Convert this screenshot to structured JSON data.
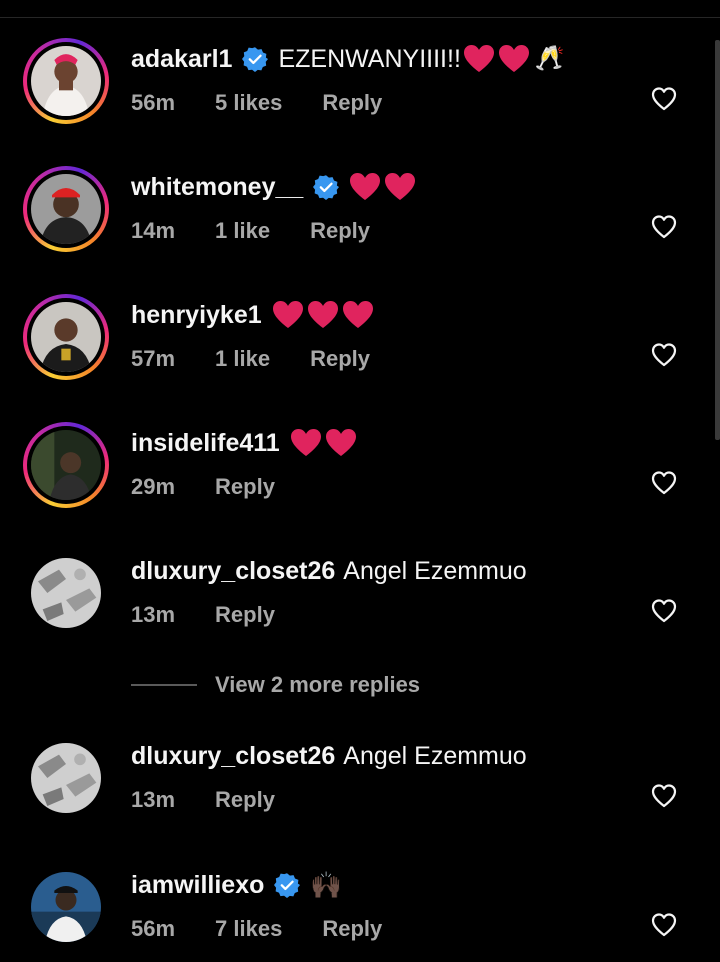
{
  "comments": [
    {
      "username": "adakarl1",
      "verified": true,
      "text": "EZENWANYIIII!!",
      "hearts": 2,
      "extra_emoji": "🥂",
      "time": "56m",
      "likes": "5 likes",
      "reply": "Reply",
      "story_ring": true
    },
    {
      "username": "whitemoney__",
      "verified": true,
      "text": "",
      "hearts": 2,
      "time": "14m",
      "likes": "1 like",
      "reply": "Reply",
      "story_ring": true
    },
    {
      "username": "henryiyke1",
      "verified": false,
      "text": "",
      "hearts": 3,
      "time": "57m",
      "likes": "1 like",
      "reply": "Reply",
      "story_ring": true
    },
    {
      "username": "insidelife411",
      "verified": false,
      "text": "",
      "hearts": 2,
      "time": "29m",
      "likes": "",
      "reply": "Reply",
      "story_ring": true
    },
    {
      "username": "dluxury_closet26",
      "verified": false,
      "text": "Angel Ezemmuo",
      "hearts": 0,
      "time": "13m",
      "likes": "",
      "reply": "Reply",
      "story_ring": false
    },
    {
      "username": "dluxury_closet26",
      "verified": false,
      "text": "Angel Ezemmuo",
      "hearts": 0,
      "time": "13m",
      "likes": "",
      "reply": "Reply",
      "story_ring": false
    },
    {
      "username": "iamwilliexo",
      "verified": true,
      "text": "",
      "hearts": 0,
      "extra_emoji": "🙌🏿",
      "time": "56m",
      "likes": "7 likes",
      "reply": "Reply",
      "story_ring": false
    }
  ],
  "view_more_replies": "View 2 more replies",
  "colors": {
    "background": "#000000",
    "primary_text": "#f5f5f5",
    "secondary_text": "#a8a8a8",
    "verified_blue": "#3897f0",
    "heart_red": "#e0245e"
  },
  "icons": {
    "verified": "verified-badge-icon",
    "like": "heart-outline-icon",
    "heart_emoji": "red-heart-emoji"
  }
}
